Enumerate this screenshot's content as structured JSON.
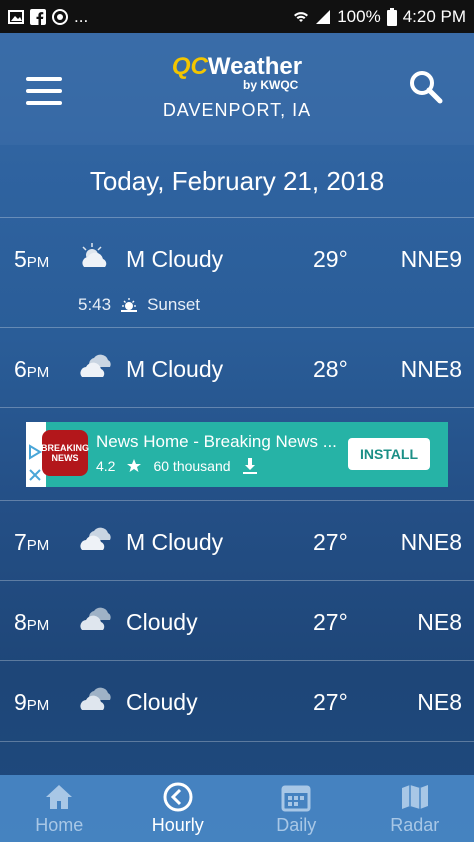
{
  "status_bar": {
    "dots": "...",
    "battery_percent": "100%",
    "time": "4:20 PM"
  },
  "header": {
    "logo_qc": "QC",
    "logo_weather": "Weather",
    "logo_by": "by KWQC",
    "city": "DAVENPORT, IA"
  },
  "date_label": "Today, February 21, 2018",
  "hours": [
    {
      "hour": "5",
      "ampm": "PM",
      "icon": "partly-cloudy-icon",
      "condition": "M Cloudy",
      "temp": "29°",
      "wind": "NNE9"
    },
    {
      "hour": "6",
      "ampm": "PM",
      "icon": "mostly-cloudy-icon",
      "condition": "M Cloudy",
      "temp": "28°",
      "wind": "NNE8"
    },
    {
      "hour": "7",
      "ampm": "PM",
      "icon": "mostly-cloudy-icon",
      "condition": "M Cloudy",
      "temp": "27°",
      "wind": "NNE8"
    },
    {
      "hour": "8",
      "ampm": "PM",
      "icon": "cloudy-icon",
      "condition": "Cloudy",
      "temp": "27°",
      "wind": "NE8"
    },
    {
      "hour": "9",
      "ampm": "PM",
      "icon": "cloudy-icon",
      "condition": "Cloudy",
      "temp": "27°",
      "wind": "NE8"
    }
  ],
  "sunset": {
    "time": "5:43",
    "label": "Sunset"
  },
  "ad": {
    "app_logo_text": "BREAKING NEWS",
    "title": "News Home - Breaking News ...",
    "rating": "4.2",
    "installs": "60 thousand",
    "install_label": "INSTALL"
  },
  "nav": [
    {
      "label": "Home",
      "icon": "home-icon",
      "active": false
    },
    {
      "label": "Hourly",
      "icon": "clock-icon",
      "active": true
    },
    {
      "label": "Daily",
      "icon": "calendar-icon",
      "active": false
    },
    {
      "label": "Radar",
      "icon": "map-icon",
      "active": false
    }
  ]
}
